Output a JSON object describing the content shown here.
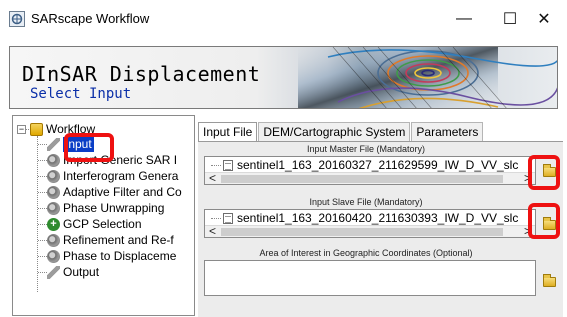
{
  "window": {
    "title": "SARscape Workflow",
    "minimize_glyph": "—",
    "maximize_glyph": "☐",
    "close_glyph": "✕"
  },
  "banner": {
    "title": "DInSAR Displacement",
    "subtitle": "Select Input"
  },
  "workflow": {
    "root_label": "Workflow",
    "expander_glyph": "−",
    "items": [
      {
        "label": "Input",
        "icon": "pencil-icon",
        "selected": true
      },
      {
        "label": "Import Generic SAR I",
        "icon": "gear-icon"
      },
      {
        "label": "Interferogram Genera",
        "icon": "gear-icon"
      },
      {
        "label": "Adaptive Filter and Co",
        "icon": "gear-icon"
      },
      {
        "label": "Phase Unwrapping",
        "icon": "gear-icon"
      },
      {
        "label": "GCP Selection",
        "icon": "plus-icon"
      },
      {
        "label": "Refinement and Re-f",
        "icon": "gear-icon"
      },
      {
        "label": "Phase to Displaceme",
        "icon": "gear-icon"
      },
      {
        "label": "Output",
        "icon": "pencil-icon"
      }
    ]
  },
  "tabs": [
    {
      "label": "Input File",
      "active": true
    },
    {
      "label": "DEM/Cartographic System",
      "active": false
    },
    {
      "label": "Parameters",
      "active": false
    }
  ],
  "input_file": {
    "master_label": "Input Master File (Mandatory)",
    "master_value": "sentinel1_163_20160327_211629599_IW_D_VV_slc",
    "slave_label": "Input Slave File (Mandatory)",
    "slave_value": "sentinel1_163_20160420_211630393_IW_D_VV_slc",
    "aoi_label": "Area of Interest in Geographic Coordinates (Optional)",
    "aoi_value": ""
  },
  "scroll": {
    "left_arrow": "<",
    "right_arrow": ">"
  },
  "colors": {
    "highlight": "#ee1111",
    "selection": "#0a3ec6",
    "banner_subtitle": "#0b2fa8"
  }
}
